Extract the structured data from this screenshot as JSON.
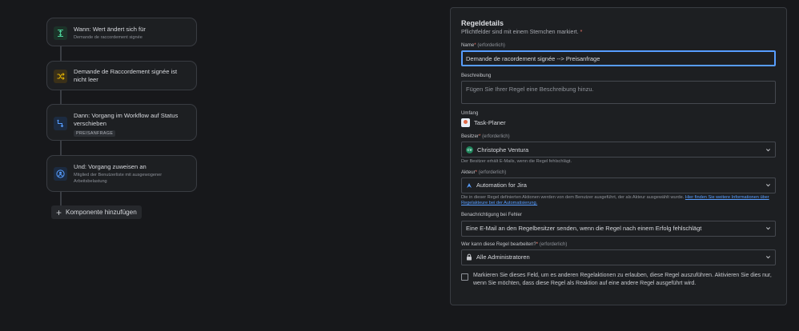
{
  "flow": {
    "cards": [
      {
        "title": "Wann: Wert ändert sich für",
        "subtitle": "Demande de raccordement signée"
      },
      {
        "title": "Demande de Raccordement signée ist nicht leer"
      },
      {
        "title": "Dann: Vorgang im Workflow auf Status verschieben",
        "badge": "PREISANFRAGE"
      },
      {
        "title": "Und: Vorgang zuweisen an",
        "subtitle": "Mitglied der Benutzerliste mit ausgewogener Arbeitsbelastung"
      }
    ],
    "add_label": "Komponente hinzufügen"
  },
  "panel": {
    "title": "Regeldetails",
    "required_note": "Pflichtfelder sind mit einem Sternchen markiert.",
    "required_mark": "*",
    "optional_text": "(erforderlich)",
    "name": {
      "label": "Name",
      "value": "Demande de racordement signée --> Preisanfrage"
    },
    "description": {
      "label": "Beschreibung",
      "placeholder": "Fügen Sie Ihrer Regel eine Beschreibung hinzu."
    },
    "scope": {
      "label": "Umfang",
      "value": "Task-Planer"
    },
    "owner": {
      "label": "Besitzer",
      "value": "Christophe Ventura",
      "initials": "CV",
      "hint": "Der Besitzer erhält E-Mails, wenn die Regel fehlschlägt."
    },
    "actor": {
      "label": "Akteur",
      "value": "Automation for Jira",
      "hint": "Die in dieser Regel definierten Aktionen werden von dem Benutzer ausgeführt, der als Akteur ausgewählt wurde.",
      "hint_link": "Hier finden Sie weitere Informationen über Regelakteure bei der Automatisierung."
    },
    "notify": {
      "label": "Benachrichtigung bei Fehler",
      "value": "Eine E-Mail an den Regelbesitzer senden, wenn die Regel nach einem Erfolg fehlschlägt"
    },
    "editors": {
      "label": "Wer kann diese Regel bearbeiten?",
      "value": "Alle Administratoren"
    },
    "checkbox_text": "Markieren Sie dieses Feld, um es anderen Regelaktionen zu erlauben, diese Regel auszuführen. Aktivieren Sie dies nur, wenn Sie möchten, dass diese Regel als Reaktion auf eine andere Regel ausgeführt wird."
  },
  "colors": {
    "accent": "#579dff",
    "required": "#f1776a",
    "background": "#17181b",
    "card": "#1d1f22"
  }
}
